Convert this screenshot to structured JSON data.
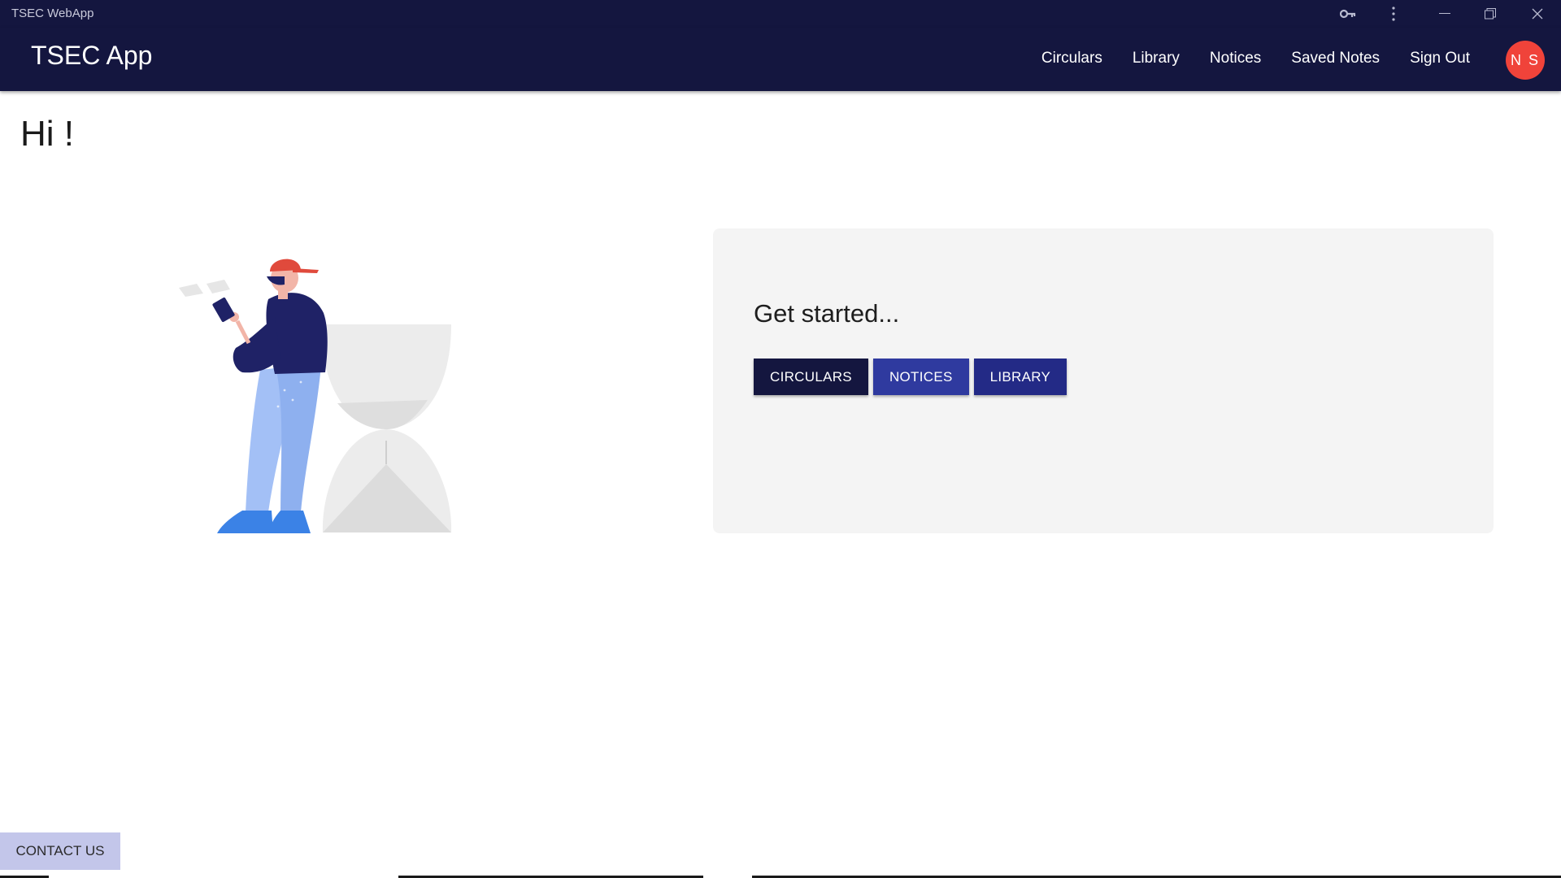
{
  "window": {
    "title": "TSEC WebApp"
  },
  "navbar": {
    "brand": "TSEC App",
    "links": [
      "Circulars",
      "Library",
      "Notices",
      "Saved Notes",
      "Sign Out"
    ],
    "avatar_initials": "N S"
  },
  "main": {
    "greeting": "Hi !",
    "card": {
      "title": "Get started...",
      "buttons": [
        "CIRCULARS",
        "NOTICES",
        "LIBRARY"
      ]
    }
  },
  "footer": {
    "contact_label": "CONTACT US"
  },
  "colors": {
    "nav_bg": "#14163f",
    "avatar": "#f0433a",
    "btn_circulars": "#14163f",
    "btn_notices": "#2f3a9f",
    "btn_library": "#232a86",
    "contact_bg": "#c3c6ea",
    "card_bg": "#f4f4f4"
  },
  "icons": [
    "key-icon",
    "more-vert-icon",
    "minimize-icon",
    "restore-icon",
    "close-icon"
  ]
}
